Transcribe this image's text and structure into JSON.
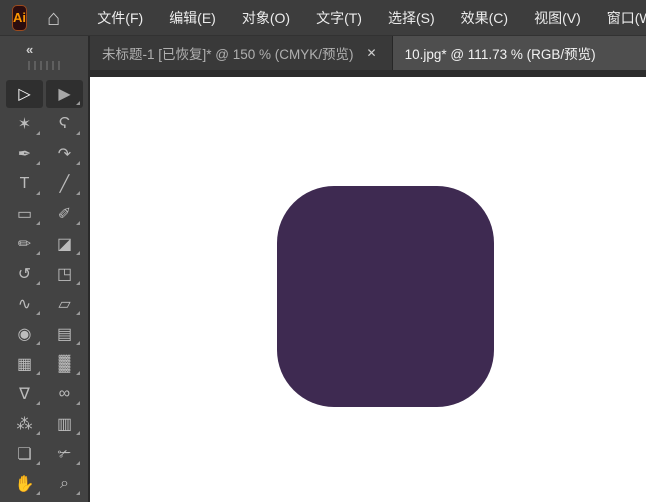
{
  "app": {
    "badge": "Ai",
    "home_icon": "⌂"
  },
  "menu_bar": {
    "items": [
      {
        "id": "file",
        "label": "文件(F)"
      },
      {
        "id": "edit",
        "label": "编辑(E)"
      },
      {
        "id": "object",
        "label": "对象(O)"
      },
      {
        "id": "type",
        "label": "文字(T)"
      },
      {
        "id": "select",
        "label": "选择(S)"
      },
      {
        "id": "effect",
        "label": "效果(C)"
      },
      {
        "id": "view",
        "label": "视图(V)"
      },
      {
        "id": "window",
        "label": "窗口(W)"
      }
    ]
  },
  "tabs": [
    {
      "id": "document-1",
      "title": "未标题-1 [已恢复]* @ 150 % (CMYK/预览)",
      "close_icon": "✕",
      "active": false
    },
    {
      "id": "document-2",
      "title": "10.jpg* @ 111.73 % (RGB/预览)",
      "active": true
    }
  ],
  "toolbar": {
    "collapse_icon": "«",
    "tools": [
      {
        "name": "selection-tool",
        "glyph": "▷",
        "selected": true
      },
      {
        "name": "direct-selection-tool",
        "glyph": "▶"
      },
      {
        "name": "magic-wand-tool",
        "glyph": "✶"
      },
      {
        "name": "lasso-tool",
        "glyph": "Ϛ"
      },
      {
        "name": "pen-tool",
        "glyph": "✒"
      },
      {
        "name": "curvature-tool",
        "glyph": "↷"
      },
      {
        "name": "type-tool",
        "glyph": "T"
      },
      {
        "name": "line-segment-tool",
        "glyph": "╱"
      },
      {
        "name": "rectangle-tool",
        "glyph": "▭"
      },
      {
        "name": "paintbrush-tool",
        "glyph": "✐"
      },
      {
        "name": "pencil-tool",
        "glyph": "✏"
      },
      {
        "name": "eraser-tool",
        "glyph": "◪"
      },
      {
        "name": "rotate-tool",
        "glyph": "↺"
      },
      {
        "name": "scale-tool",
        "glyph": "◳"
      },
      {
        "name": "width-tool",
        "glyph": "∿"
      },
      {
        "name": "free-transform-tool",
        "glyph": "▱"
      },
      {
        "name": "shape-builder-tool",
        "glyph": "◉"
      },
      {
        "name": "perspective-grid-tool",
        "glyph": "▤"
      },
      {
        "name": "mesh-tool",
        "glyph": "▦"
      },
      {
        "name": "gradient-tool",
        "glyph": "▓"
      },
      {
        "name": "eyedropper-tool",
        "glyph": "∇"
      },
      {
        "name": "blend-tool",
        "glyph": "∞"
      },
      {
        "name": "symbol-sprayer-tool",
        "glyph": "⁂"
      },
      {
        "name": "column-graph-tool",
        "glyph": "▥"
      },
      {
        "name": "artboard-tool",
        "glyph": "❏"
      },
      {
        "name": "slice-tool",
        "glyph": "✃"
      },
      {
        "name": "hand-tool",
        "glyph": "✋"
      },
      {
        "name": "zoom-tool",
        "glyph": "⌕"
      }
    ]
  },
  "canvas": {
    "artwork": {
      "shape": "rounded-square",
      "fill": "#3E2A51"
    },
    "background": "#FFFFFF"
  },
  "colors": {
    "accent_orange": "#FF9800",
    "logo_background": "#2B0D0F",
    "panel_gray": "#434343",
    "menubar_gray": "#3D3D3D",
    "tab_active": "#4E4E4E",
    "tab_inactive": "#393939",
    "artwork_purple": "#3E2A51"
  }
}
